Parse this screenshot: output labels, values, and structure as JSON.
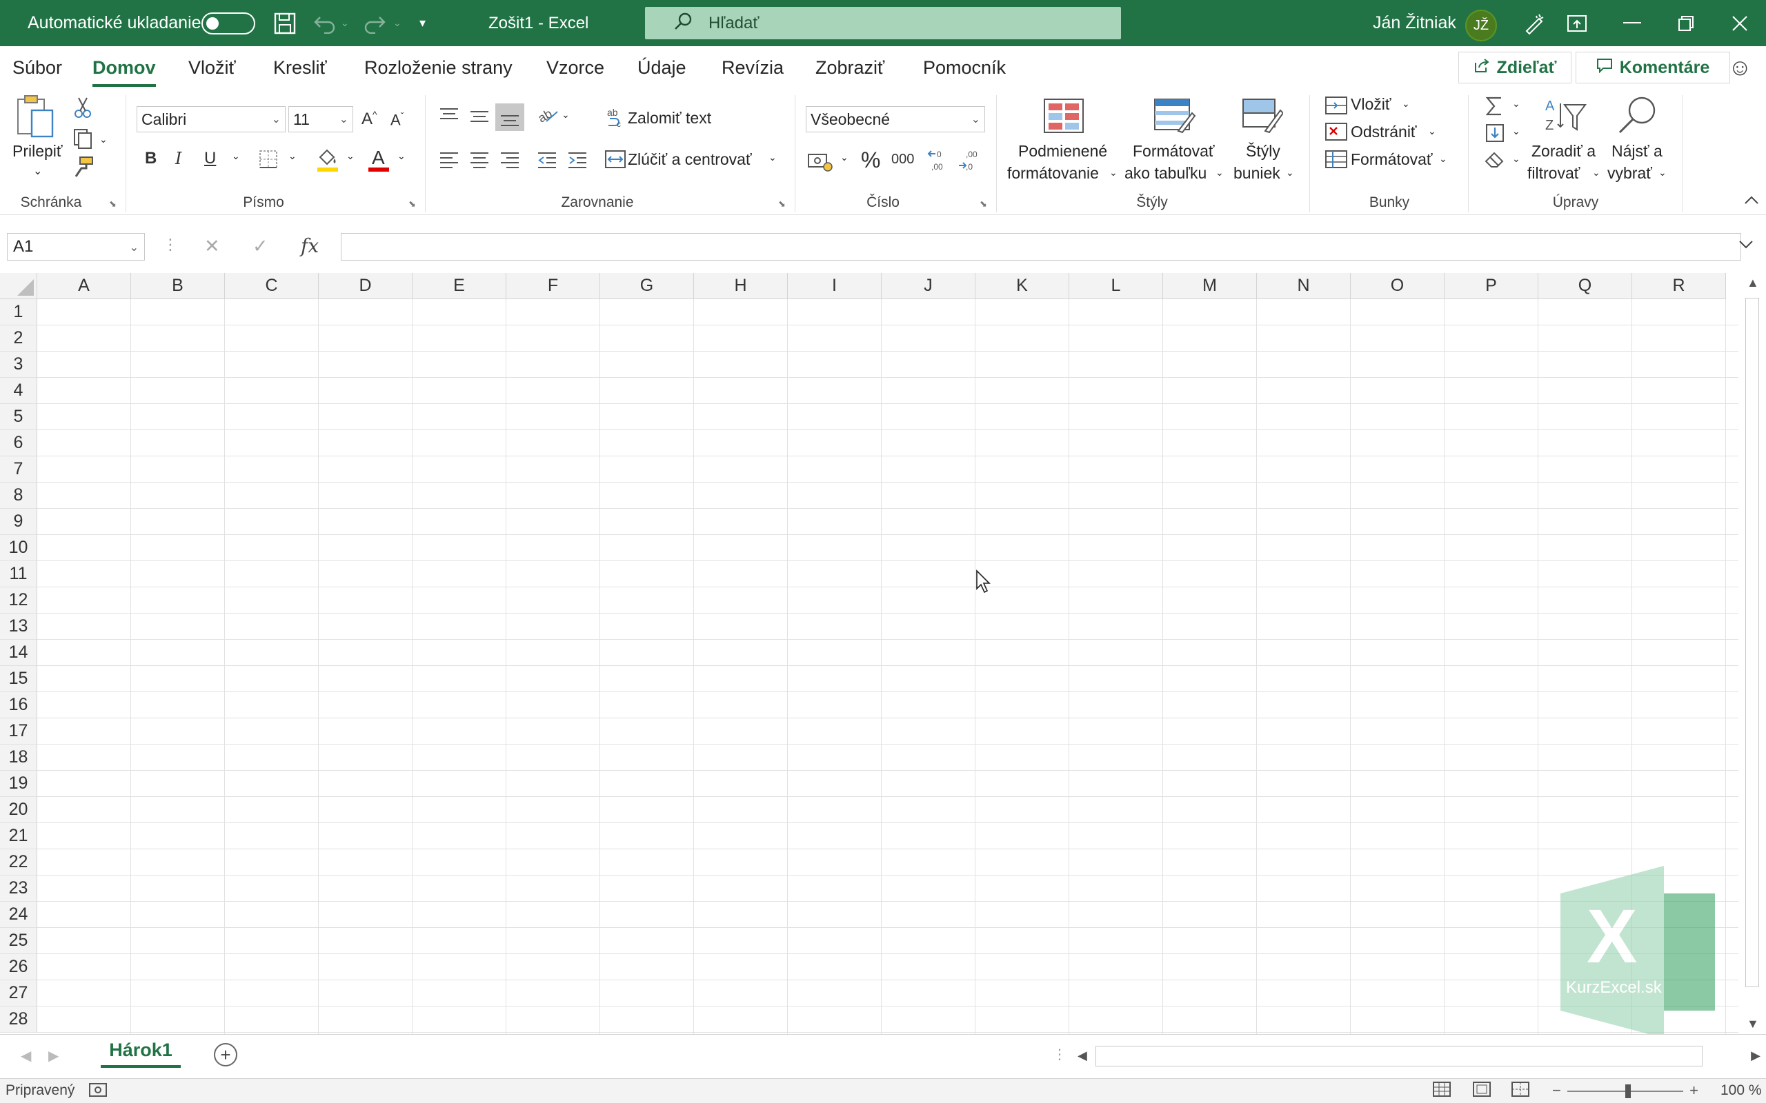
{
  "titlebar": {
    "autosave_label": "Automatické ukladanie",
    "doc_title": "Zošit1  -  Excel",
    "search_placeholder": "Hľadať",
    "user_name": "Ján Žitniak",
    "user_initials": "JŽ"
  },
  "menu": {
    "tabs": [
      "Súbor",
      "Domov",
      "Vložiť",
      "Kresliť",
      "Rozloženie strany",
      "Vzorce",
      "Údaje",
      "Revízia",
      "Zobraziť",
      "Pomocník"
    ],
    "active_tab": "Domov",
    "share_label": "Zdieľať",
    "comments_label": "Komentáre"
  },
  "ribbon": {
    "clipboard": {
      "label": "Schránka",
      "paste": "Prilepiť"
    },
    "font": {
      "label": "Písmo",
      "font_name": "Calibri",
      "font_size": "11",
      "bold": "B",
      "italic": "I",
      "underline": "U"
    },
    "alignment": {
      "label": "Zarovnanie",
      "wrap_text": "Zalomiť text",
      "merge_center": "Zlúčiť a centrovať"
    },
    "number": {
      "label": "Číslo",
      "format": "Všeobecné",
      "percent": "%",
      "thousands": "000"
    },
    "styles": {
      "label": "Štýly",
      "conditional_1": "Podmienené",
      "conditional_2": "formátovanie",
      "format_table_1": "Formátovať",
      "format_table_2": "ako tabuľku",
      "cell_styles_1": "Štýly",
      "cell_styles_2": "buniek"
    },
    "cells": {
      "label": "Bunky",
      "insert": "Vložiť",
      "delete": "Odstrániť",
      "format": "Formátovať"
    },
    "editing": {
      "label": "Úpravy",
      "sort_1": "Zoradiť a",
      "sort_2": "filtrovať",
      "find_1": "Nájsť a",
      "find_2": "vybrať"
    }
  },
  "formulabar": {
    "name_box": "A1",
    "fx": "fx",
    "formula": ""
  },
  "grid": {
    "columns": [
      "A",
      "B",
      "C",
      "D",
      "E",
      "F",
      "G",
      "H",
      "I",
      "J",
      "K",
      "L",
      "M",
      "N",
      "O",
      "P",
      "Q",
      "R"
    ],
    "rows": [
      "1",
      "2",
      "3",
      "4",
      "5",
      "6",
      "7",
      "8",
      "9",
      "10",
      "11",
      "12",
      "13",
      "14",
      "15",
      "16",
      "17",
      "18",
      "19",
      "20",
      "21",
      "22",
      "23",
      "24",
      "25",
      "26",
      "27",
      "28"
    ]
  },
  "watermark": {
    "letter": "X",
    "text": "KurzExcel.sk"
  },
  "sheets": {
    "tabs": [
      "Hárok1"
    ]
  },
  "status": {
    "ready": "Pripravený",
    "zoom": "100 %"
  },
  "colors": {
    "accent": "#217346",
    "search_bg": "#a8d5ba",
    "grid_line": "#e1e1e1"
  }
}
